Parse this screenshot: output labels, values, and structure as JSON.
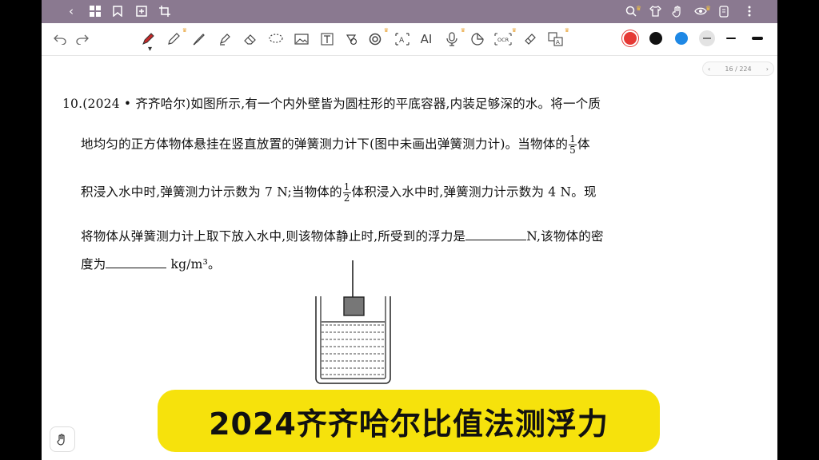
{
  "topbar": {
    "left_icons": [
      "back-chevron-icon",
      "grid-icon",
      "bookmark-icon",
      "add-page-icon",
      "crop-icon"
    ],
    "right_icons": [
      "search-icon",
      "shirt-icon",
      "hand-icon",
      "eye-icon",
      "tablet-icon",
      "more-icon"
    ]
  },
  "toolbar": {
    "tools": [
      "undo-icon",
      "redo-icon",
      "pen-icon",
      "pencil-icon",
      "brush-icon",
      "highlighter-icon",
      "eraser-icon",
      "lasso-icon",
      "image-icon",
      "text-icon",
      "shape-icon",
      "link-icon",
      "ocr-text-icon",
      "ai-icon",
      "mic-icon",
      "sticker-icon",
      "ocr-icon",
      "tape-icon",
      "translate-icon"
    ],
    "ai_label": "AI",
    "text_label": "T",
    "ocr_label": "OCR",
    "colors": [
      "#e53935",
      "#111111",
      "#1e88e5",
      "#e0e0e0"
    ]
  },
  "page_nav": {
    "label": "16 / 224",
    "prev": "‹",
    "next": "›"
  },
  "question": {
    "number": "10.",
    "line1": "(2024 • 齐齐哈尔)如图所示,有一个内外壁皆为圆柱形的平底容器,内装足够深的水。将一个质",
    "line2_a": "地均匀的正方体物体悬挂在竖直放置的弹簧测力计下(图中未画出弹簧测力计)。当物体的",
    "frac1_num": "1",
    "frac1_den": "5",
    "line2_b": "体",
    "line3_a": "积浸入水中时,弹簧测力计示数为 7 N;当物体的",
    "frac2_num": "1",
    "frac2_den": "2",
    "line3_b": "体积浸入水中时,弹簧测力计示数为 4 N。现",
    "line4_a": "将物体从弹簧测力计上取下放入水中,则该物体静止时,所受到的浮力是",
    "line4_b": "N,该物体的密",
    "line5_a": "度为",
    "line5_b": "kg/m³。"
  },
  "banner": {
    "text": "2024齐齐哈尔比值法测浮力",
    "color": "#f6e20c"
  }
}
